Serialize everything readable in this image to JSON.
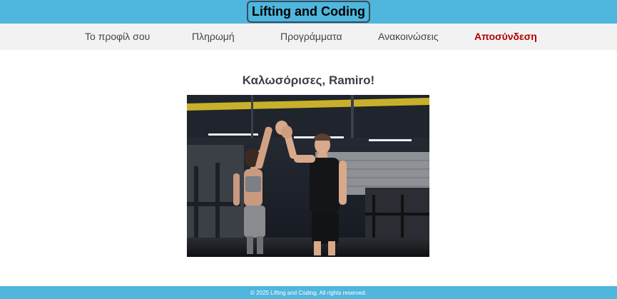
{
  "header": {
    "brand": "Lifting and Coding",
    "brand_color": "#4fb6de"
  },
  "nav": {
    "items": [
      {
        "label": "Το προφίλ σου"
      },
      {
        "label": "Πληρωμή"
      },
      {
        "label": "Προγράμματα"
      },
      {
        "label": "Ανακοινώσεις"
      },
      {
        "label": "Αποσύνδεση",
        "color": "#b00000"
      }
    ]
  },
  "main": {
    "welcome": "Καλωσόρισες, Ramiro!",
    "hero_image": "gym-high-five-photo"
  },
  "footer": {
    "copyright": "© 2025 Lifting and Coding. All rights reserved."
  }
}
